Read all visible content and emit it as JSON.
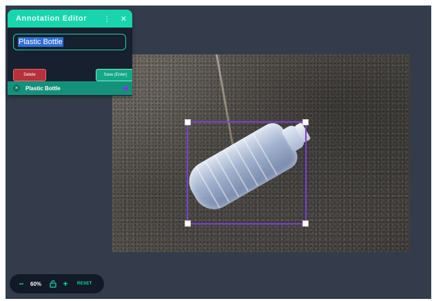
{
  "editor": {
    "title": "Annotation Editor",
    "menu_icon": "kebab-icon",
    "close_icon": "close-icon",
    "name_value": "Plastic Bottle",
    "delete_label": "Delete",
    "save_label": "Save (Enter)"
  },
  "annotations": [
    {
      "label": "Plastic Bottle",
      "color": "#7b3fd6"
    }
  ],
  "zoom": {
    "minus_label": "−",
    "value": "60%",
    "plus_label": "+",
    "reset_label": "RESET",
    "lock_icon": "lock-icon"
  },
  "colors": {
    "accent": "#19d5ae",
    "bbox": "#7b3fd6",
    "danger": "#b8303a",
    "background": "#343c4c"
  }
}
